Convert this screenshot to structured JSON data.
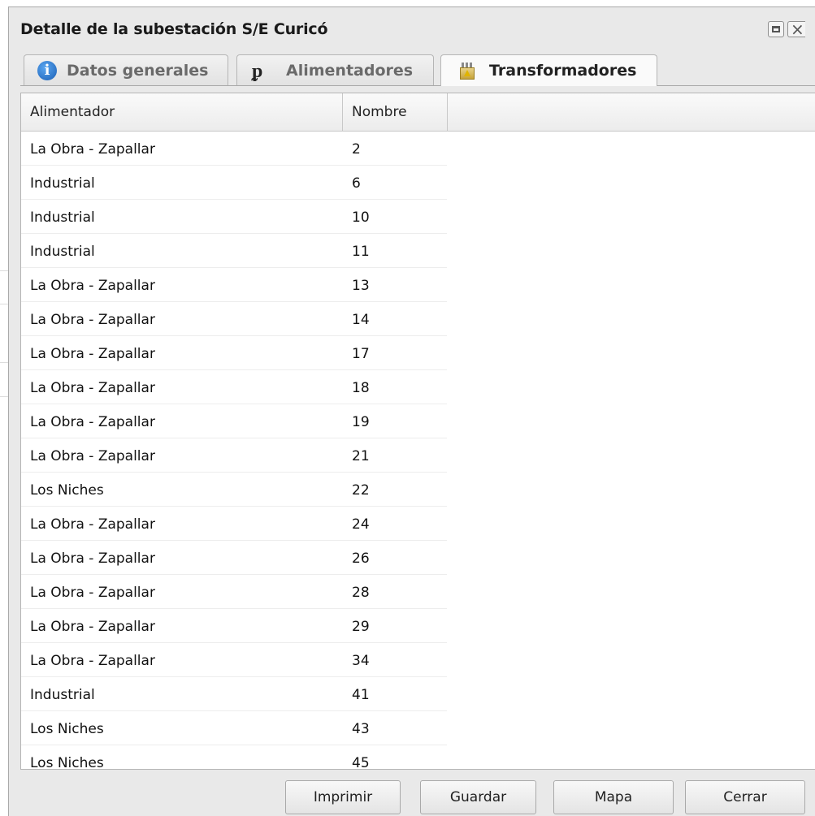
{
  "window": {
    "title": "Detalle de la subestación S/E Curicó",
    "close_glyph": "×"
  },
  "tabs": [
    {
      "label": "Datos generales",
      "icon": "info-icon",
      "active": false
    },
    {
      "label": "Alimentadores",
      "icon": "feeder-icon",
      "active": false
    },
    {
      "label": "Transformadores",
      "icon": "transformer-icon",
      "active": true
    }
  ],
  "grid": {
    "columns": [
      "Alimentador",
      "Nombre"
    ],
    "rows": [
      {
        "alimentador": "La Obra - Zapallar",
        "nombre": "2"
      },
      {
        "alimentador": "Industrial",
        "nombre": "6"
      },
      {
        "alimentador": "Industrial",
        "nombre": "10"
      },
      {
        "alimentador": "Industrial",
        "nombre": "11"
      },
      {
        "alimentador": "La Obra - Zapallar",
        "nombre": "13"
      },
      {
        "alimentador": "La Obra - Zapallar",
        "nombre": "14"
      },
      {
        "alimentador": "La Obra - Zapallar",
        "nombre": "17"
      },
      {
        "alimentador": "La Obra - Zapallar",
        "nombre": "18"
      },
      {
        "alimentador": "La Obra - Zapallar",
        "nombre": "19"
      },
      {
        "alimentador": "La Obra - Zapallar",
        "nombre": "21"
      },
      {
        "alimentador": "Los Niches",
        "nombre": "22"
      },
      {
        "alimentador": "La Obra - Zapallar",
        "nombre": "24"
      },
      {
        "alimentador": "La Obra - Zapallar",
        "nombre": "26"
      },
      {
        "alimentador": "La Obra - Zapallar",
        "nombre": "28"
      },
      {
        "alimentador": "La Obra - Zapallar",
        "nombre": "29"
      },
      {
        "alimentador": "La Obra - Zapallar",
        "nombre": "34"
      },
      {
        "alimentador": "Industrial",
        "nombre": "41"
      },
      {
        "alimentador": "Los Niches",
        "nombre": "43"
      },
      {
        "alimentador": "Los Niches",
        "nombre": "45"
      }
    ]
  },
  "footer": {
    "print_label": "Imprimir",
    "save_label": "Guardar",
    "map_label": "Mapa",
    "close_label": "Cerrar"
  },
  "colors": {
    "window_bg": "#e9e9e9",
    "border": "#a9a9a9",
    "info_icon_blue": "#1b5fb5"
  }
}
